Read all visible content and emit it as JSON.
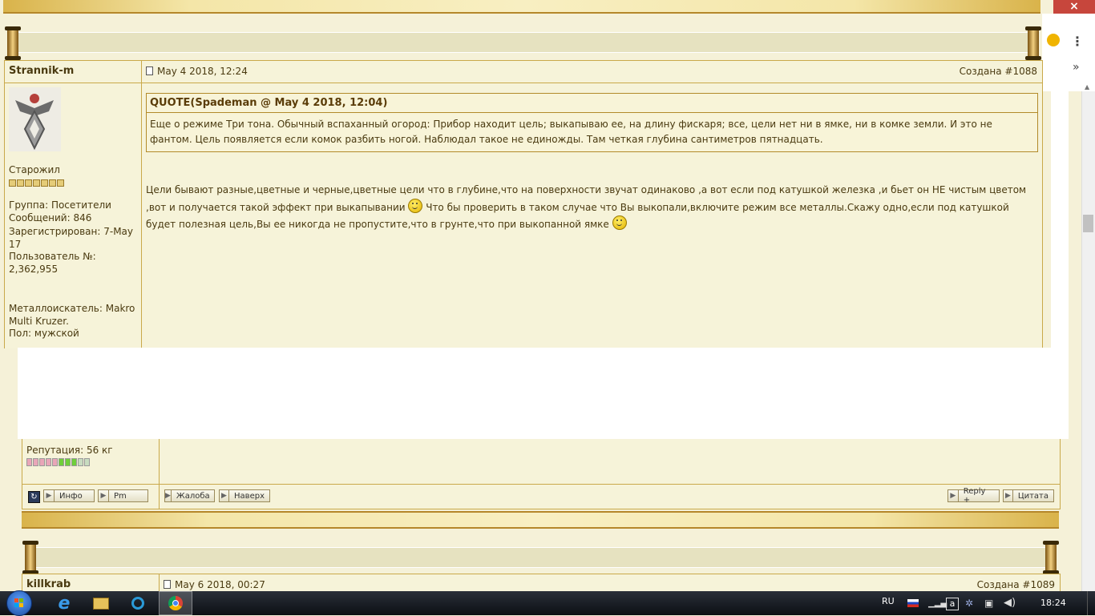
{
  "browser": {
    "close_label": "×",
    "menu_label": "⋮",
    "more_label": "»"
  },
  "post1": {
    "author": "Strannik-m",
    "date": "May 4 2018, 12:24",
    "post_id": "Создана #1088",
    "rank": "Старожил",
    "group": "Группа: Посетители",
    "messages": "Сообщений: 846",
    "registered": "Зарегистрирован: 7-May 17",
    "user_no_label": "Пользователь №:",
    "user_no": "2,362,955",
    "detector": "Металлоискатель: Makro Multi Kruzer.",
    "gender": "Пол: мужской",
    "reputation": "Репутация: 56 кг",
    "quote_title": "QUOTE(Spademan @ May 4 2018, 12:04)",
    "quote_text": "Еще о режиме Три тона. Обычный вспаханный огород: Прибор находит цель; выкапываю ее, на длину фискаря; все, цели нет ни в ямке, ни в комке земли. И это не фантом. Цель появляется если комок разбить ногой. Наблюдал такое не единожды. Там четкая глубина сантиметров пятнадцать.",
    "text_part1": "Цели бывают разные,цветные и черные,цветные цели что в глубине,что на поверхности звучат одинаково ,а вот если под катушкой железка ,и бьет он НЕ чистым цветом ,вот и получается такой эффект при выкапывании",
    "text_part2": " Что бы проверить в таком случае что Вы выкопали,включите режим все металлы.Скажу одно,если под катушкой будет полезная цель,Вы ее никогда не пропустите,что в грунте,что при выкопанной ямке",
    "btn_info": "Инфо",
    "btn_pm": "Pm",
    "btn_complaint": "Жалоба",
    "btn_top": "Наверх",
    "btn_reply": "Reply +",
    "btn_quote": "Цитата"
  },
  "post2": {
    "author": "killkrab",
    "date": "May 6 2018, 00:27",
    "post_id": "Создана #1089"
  },
  "taskbar": {
    "lang": "RU",
    "time": "18:24"
  }
}
